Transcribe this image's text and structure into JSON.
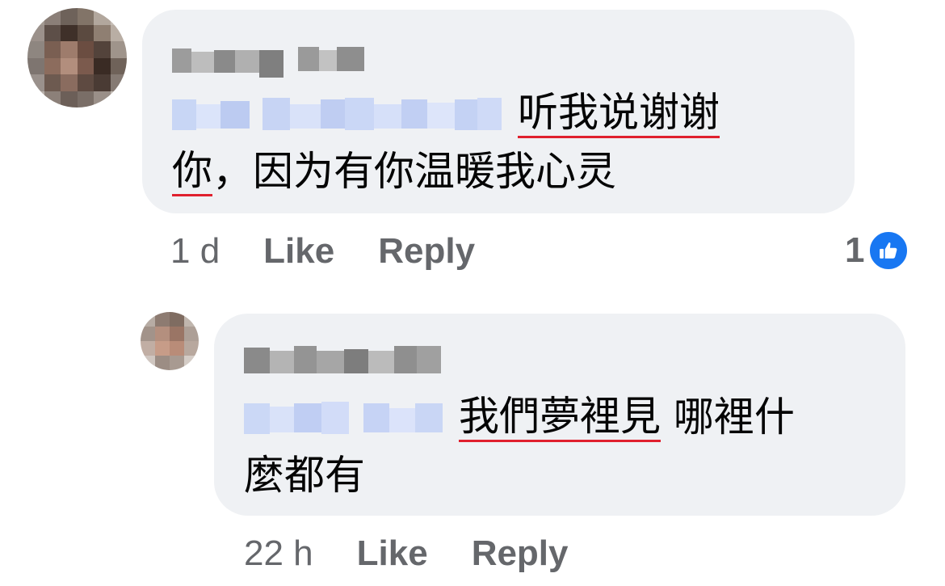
{
  "comment": {
    "author_name": "",
    "mention": "",
    "text_line1": "听我说谢谢",
    "text_line2_underlined": "你",
    "text_line2_rest": "，因为有你温暖我心灵",
    "time": "1 d",
    "like_label": "Like",
    "reply_label": "Reply",
    "reaction_count": "1",
    "reaction_icon": "thumbs-up-icon",
    "colors": {
      "bubble": "#eff1f4",
      "underline": "#e0202e",
      "meta": "#65676b",
      "like_badge": "#1877f2"
    }
  },
  "reply": {
    "author_name": "",
    "mention": "",
    "text_underlined": "我們夢裡見",
    "text_rest": " 哪裡什",
    "text_line2": "麼都有",
    "time": "22 h",
    "like_label": "Like",
    "reply_label": "Reply"
  }
}
